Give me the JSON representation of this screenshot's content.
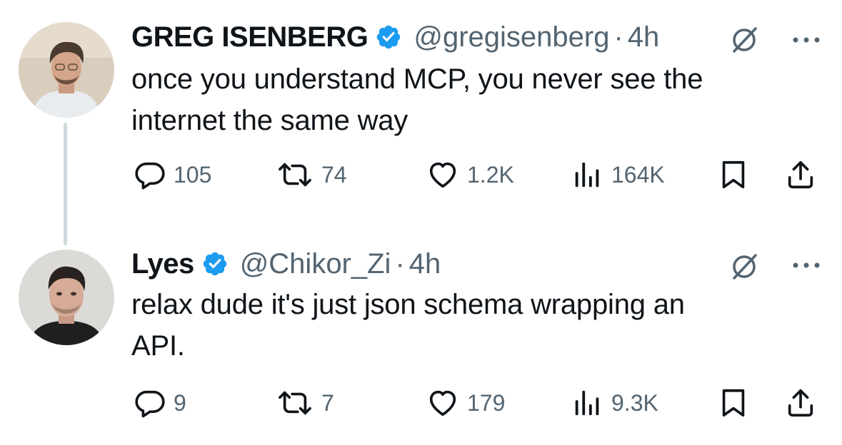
{
  "tweets": [
    {
      "name": "GREG ISENBERG",
      "handle": "@gregisenberg",
      "separator": "·",
      "time": "4h",
      "text_lines": [
        "once you understand MCP, you never see the",
        "internet the same way"
      ],
      "replies": "105",
      "reposts": "74",
      "likes": "1.2K",
      "views": "164K"
    },
    {
      "name": "Lyes",
      "handle": "@Chikor_Zi",
      "separator": "·",
      "time": "4h",
      "text_lines": [
        "relax dude it's just json schema wrapping an",
        "API."
      ],
      "replies": "9",
      "reposts": "7",
      "likes": "179",
      "views": "9.3K"
    }
  ],
  "colors": {
    "text": "#0f1419",
    "secondary": "#536471",
    "verified": "#1d9bf0",
    "thread_line": "#cfd9de"
  },
  "icons": [
    "verified-badge-icon",
    "grok-icon",
    "more-icon",
    "reply-icon",
    "repost-icon",
    "like-icon",
    "views-icon",
    "bookmark-icon",
    "share-icon"
  ]
}
